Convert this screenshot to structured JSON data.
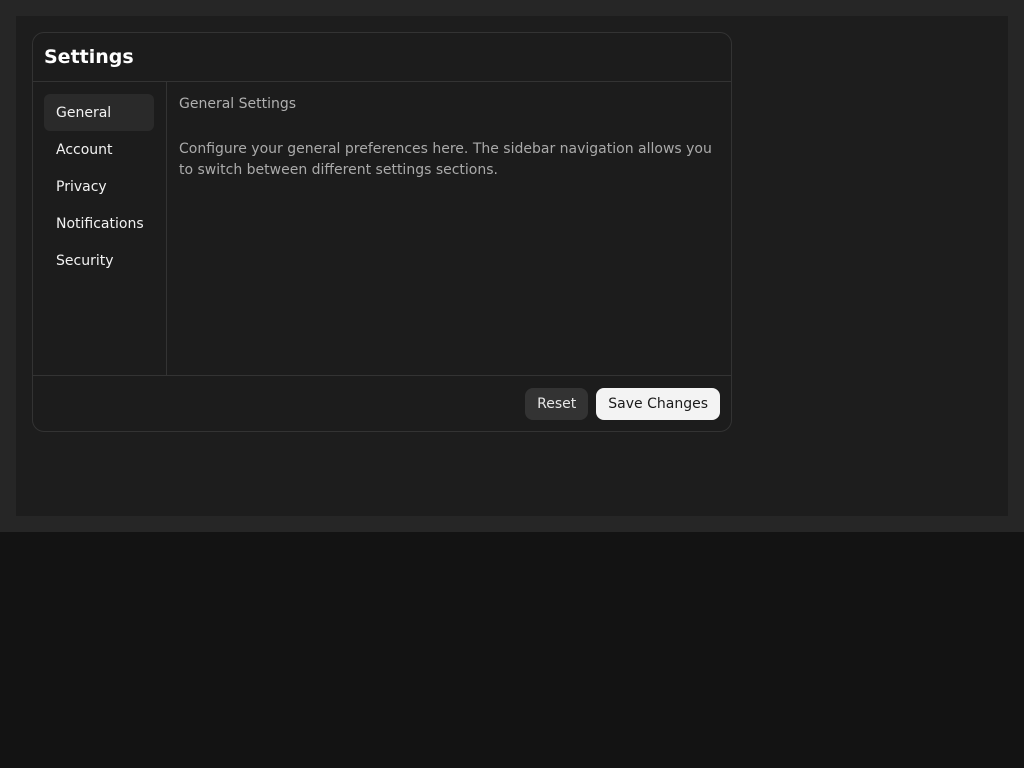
{
  "dialog": {
    "title": "Settings"
  },
  "sidebar": {
    "items": [
      {
        "label": "General",
        "active": true
      },
      {
        "label": "Account",
        "active": false
      },
      {
        "label": "Privacy",
        "active": false
      },
      {
        "label": "Notifications",
        "active": false
      },
      {
        "label": "Security",
        "active": false
      }
    ]
  },
  "content": {
    "title": "General Settings",
    "description": "Configure your general preferences here. The sidebar navigation allows you to switch between different settings sections."
  },
  "footer": {
    "reset_label": "Reset",
    "save_label": "Save Changes"
  },
  "colors": {
    "background": "#131313",
    "frame": "#262626",
    "canvas": "#1d1d1d",
    "dialog": "#1c1c1c",
    "border": "#333333",
    "active_item": "#2a2a2a",
    "primary_button": "#f3f3f3",
    "secondary_button": "#333333"
  }
}
